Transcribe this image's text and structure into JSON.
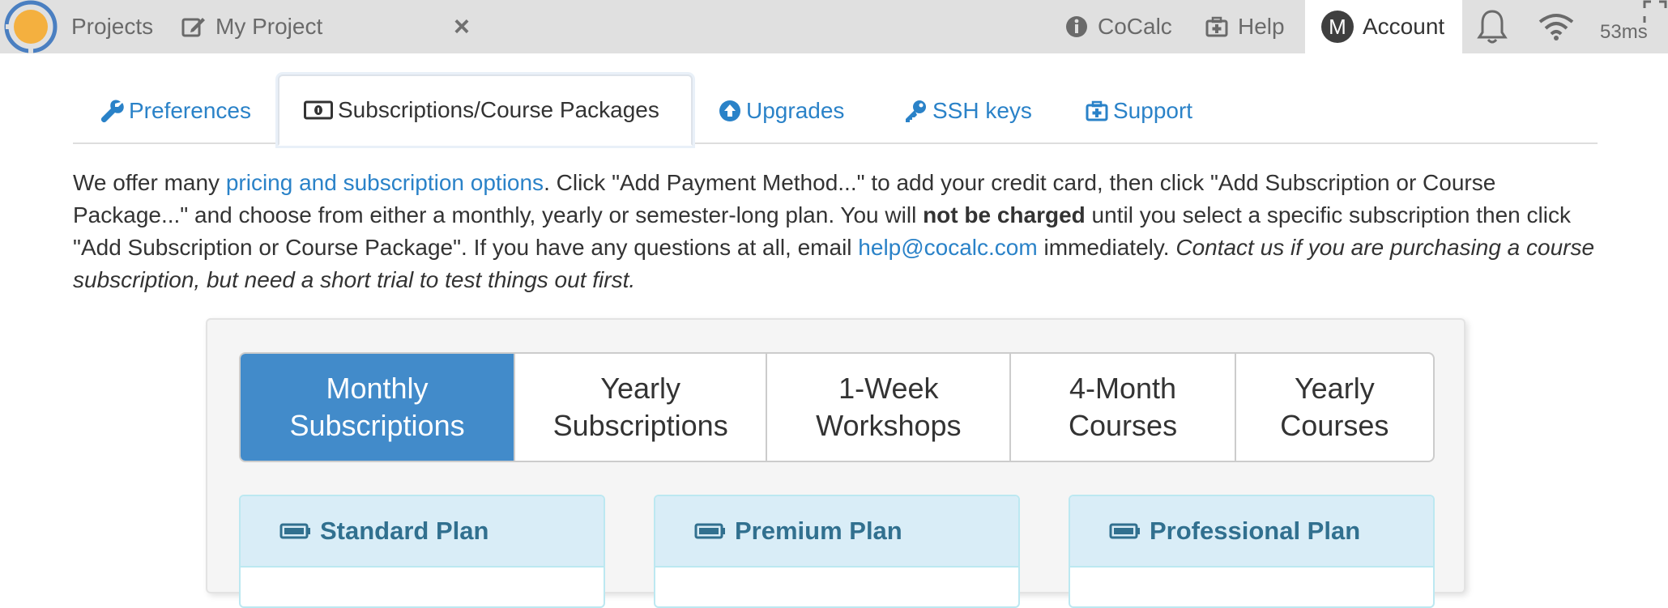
{
  "topbar": {
    "projects": "Projects",
    "project_tab": "My Project",
    "close_symbol": "×",
    "cocalc": "CoCalc",
    "help": "Help",
    "account_initial": "M",
    "account": "Account",
    "ping": "53ms"
  },
  "tabs": [
    {
      "label": "Preferences",
      "icon": "wrench-icon"
    },
    {
      "label": "Subscriptions/Course Packages",
      "icon": "money-icon",
      "active": true
    },
    {
      "label": "Upgrades",
      "icon": "arrow-circle-up-icon"
    },
    {
      "label": "SSH keys",
      "icon": "key-icon"
    },
    {
      "label": "Support",
      "icon": "medkit-icon"
    }
  ],
  "intro": {
    "t1": "We offer many ",
    "link_pricing": "pricing and subscription options",
    "t2": ". Click \"Add Payment Method...\" to add your credit card, then click \"Add Subscription or Course Package...\" and choose from either a monthly, yearly or semester-long plan. You will ",
    "bold": "not be charged",
    "t3": " until you select a specific subscription then click \"Add Subscription or Course Package\".  If you have any questions at all, email ",
    "link_email": "help@cocalc.com",
    "t4": " immediately.  ",
    "italic": "Contact us if you are purchasing a course subscription, but need a short trial to test things out first."
  },
  "period_tabs": [
    {
      "line1": "Monthly",
      "line2": "Subscriptions",
      "active": true
    },
    {
      "line1": "Yearly",
      "line2": "Subscriptions"
    },
    {
      "line1": "1-Week",
      "line2": "Workshops"
    },
    {
      "line1": "4-Month",
      "line2": "Courses"
    },
    {
      "line1": "Yearly",
      "line2": "Courses"
    }
  ],
  "plans": [
    {
      "name": "Standard Plan",
      "icon": "battery-icon"
    },
    {
      "name": "Premium Plan",
      "icon": "battery-icon"
    },
    {
      "name": "Professional Plan",
      "icon": "battery-icon"
    }
  ],
  "colors": {
    "topbar_bg": "#e0e0e0",
    "link": "#2a82c8",
    "active_period": "#428bca",
    "plan_header_bg": "#d9edf7",
    "plan_header_text": "#31708f",
    "logo_orange": "#f4b03f",
    "logo_blue": "#4a7fc1"
  }
}
